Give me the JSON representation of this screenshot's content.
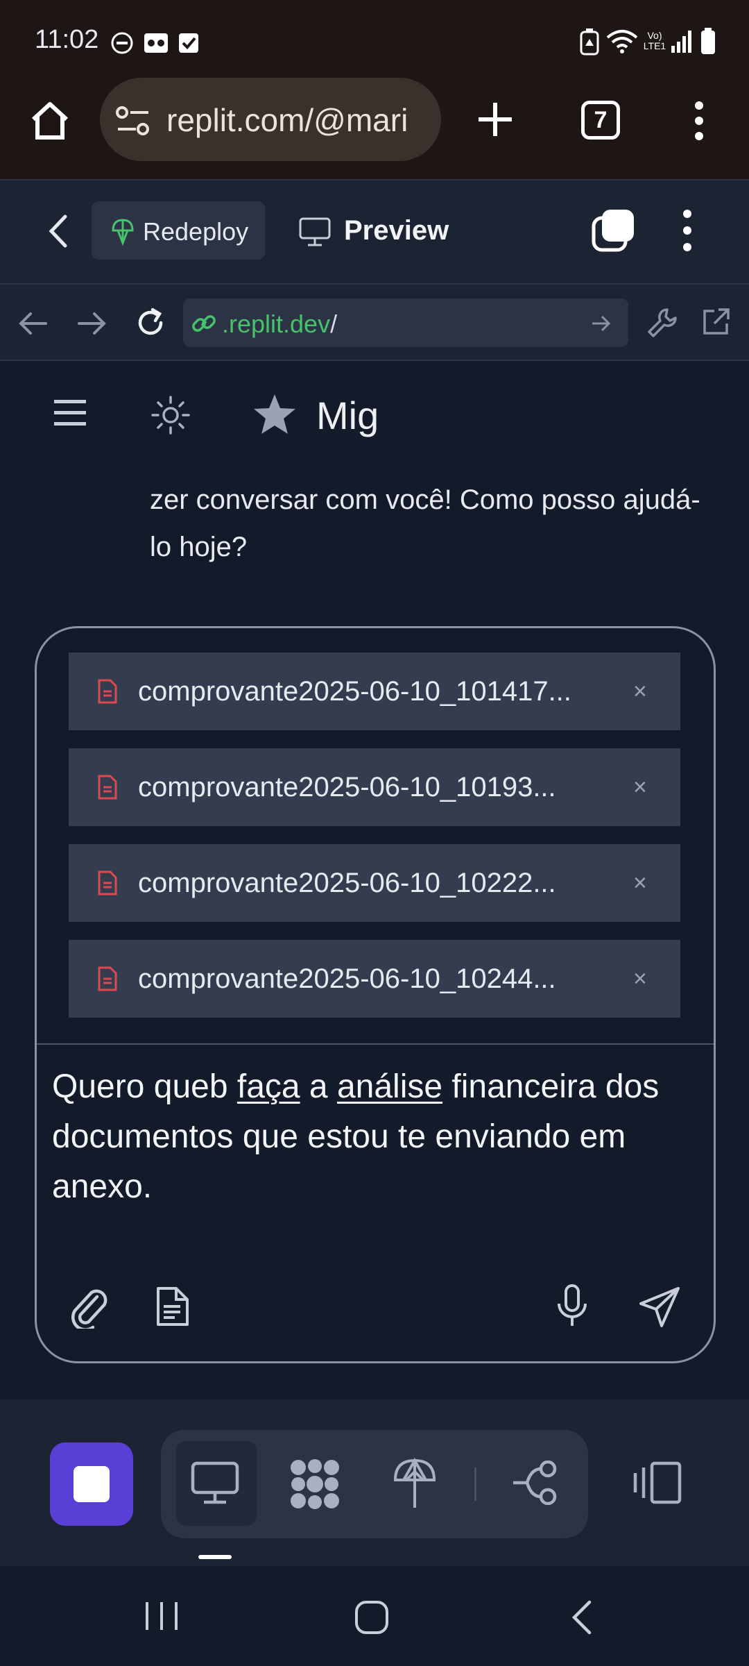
{
  "status_bar": {
    "time": "11:02",
    "network": "Vo) LTE1"
  },
  "browser": {
    "url": "replit.com/@mari",
    "tab_count": "7"
  },
  "replit_header": {
    "redeploy_label": "Redeploy",
    "preview_label": "Preview"
  },
  "webview": {
    "address_host": ".replit.dev",
    "address_path": "/"
  },
  "app": {
    "title": "Mig",
    "partial_message": "zer conversar com você! Como posso ajudá-lo hoje?"
  },
  "composer": {
    "attachments": [
      {
        "name": "comprovante2025-06-10_101417..."
      },
      {
        "name": "comprovante2025-06-10_10193..."
      },
      {
        "name": "comprovante2025-06-10_10222..."
      },
      {
        "name": "comprovante2025-06-10_10244..."
      }
    ],
    "remove_glyph": "×",
    "text_parts": [
      "Quero queb ",
      "faça",
      " a ",
      "análise",
      " financeira dos documentos que estou te enviando em anexo."
    ]
  },
  "colors": {
    "accent": "#5a3fd6",
    "link_green": "#47c26b",
    "file_icon": "#e0484f"
  }
}
